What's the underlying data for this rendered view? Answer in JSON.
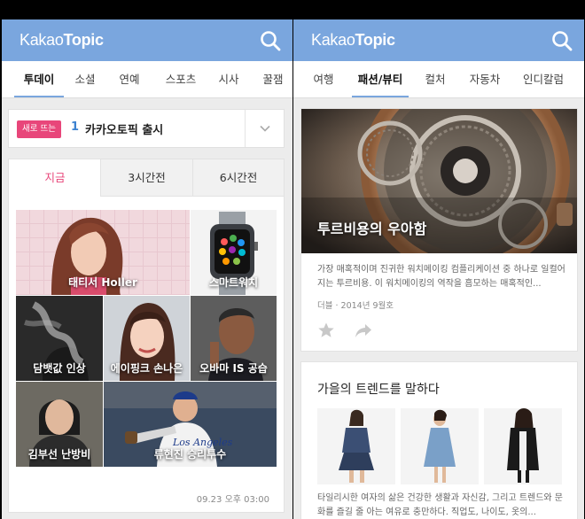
{
  "left": {
    "logo": {
      "prefix": "Kakao",
      "bold": "Topic"
    },
    "tabs": [
      {
        "label": "투데이",
        "active": true
      },
      {
        "label": "소셜"
      },
      {
        "label": "연예"
      },
      {
        "label": "스포츠"
      },
      {
        "label": "시사"
      },
      {
        "label": "꿀잼"
      }
    ],
    "rising": {
      "badge": "새로 뜨는",
      "rank": "1",
      "text": "카카오토픽 출시"
    },
    "time_tabs": [
      {
        "label": "지금",
        "active": true
      },
      {
        "label": "3시간전"
      },
      {
        "label": "6시간전"
      }
    ],
    "tiles": [
      {
        "label": "태티서 Holler"
      },
      {
        "label": "스마트워치"
      },
      {
        "label": "담뱃값 인상"
      },
      {
        "label": "에이핑크 손나은"
      },
      {
        "label": "오바마 IS 공습"
      },
      {
        "label": "김부선 난방비"
      },
      {
        "label": "류현진 승리투수"
      }
    ],
    "timestamp": "09.23 오후 03:00"
  },
  "right": {
    "logo": {
      "prefix": "Kakao",
      "bold": "Topic"
    },
    "tabs": [
      {
        "label": "여행"
      },
      {
        "label": "패션/뷰티",
        "active": true
      },
      {
        "label": "컬처"
      },
      {
        "label": "자동차"
      },
      {
        "label": "인디칼럼"
      }
    ],
    "article": {
      "title": "투르비용의 우아함",
      "desc": "가장 매혹적이며 진귀한 워치메이킹 컴플리케이션 중 하나로 일컬어지는 투르비용. 이 워치메이킹의 역작을 흠모하는 매혹적인...",
      "meta": "더블 · 2014년 9월호"
    },
    "trend": {
      "title": "가을의 트렌드를 말하다",
      "desc": "타일리시한 여자의 삶은 건강한 생활과 자신감, 그리고 트렌드와 문화를 즐길 줄 아는 여유로 충만하다. 직업도, 나이도, 옷의..."
    }
  },
  "colors": {
    "appbar": "#7aa6de",
    "accent_pink": "#e8467a",
    "rank_blue": "#3c82d0"
  },
  "icons": [
    "search-icon",
    "chevron-down-icon",
    "star-icon",
    "share-icon"
  ]
}
